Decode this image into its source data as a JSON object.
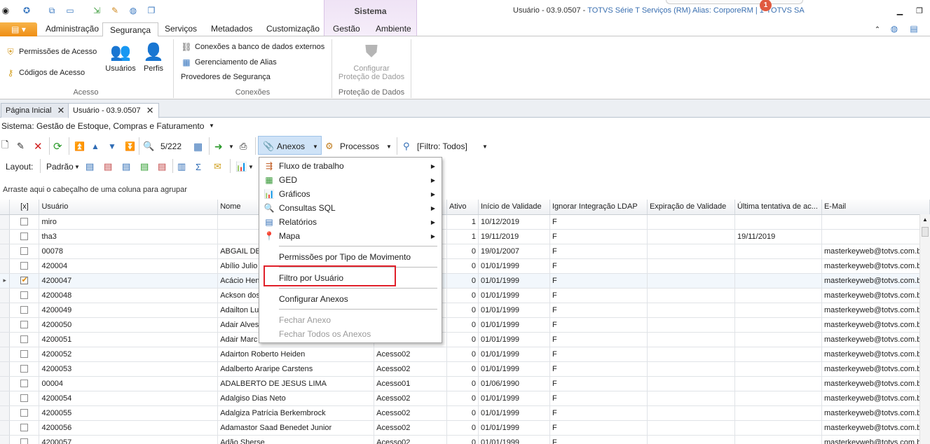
{
  "window": {
    "title_main": "Usuário - 03.9.0507 - ",
    "title_app": "TOTVS Série T Serviços (RM) Alias: CorporeRM | 1-TOTVS SA",
    "context_tab": "Sistema",
    "notification_count": "1"
  },
  "ribbon": {
    "tabs": [
      "Administração",
      "Segurança",
      "Serviços",
      "Metadados",
      "Customização",
      "Gestão",
      "Ambiente"
    ],
    "active_tab": "Segurança",
    "groups": {
      "acesso": {
        "label": "Acesso",
        "permissoes": "Permissões de Acesso",
        "codigos": "Códigos de Acesso",
        "usuarios": "Usuários",
        "perfis": "Perfis"
      },
      "conexoes": {
        "label": "Conexões",
        "banco": "Conexões a banco de dados externos",
        "alias": "Gerenciamento de Alias",
        "provedores": "Provedores de Segurança"
      },
      "protecao": {
        "label": "Proteção de Dados",
        "configurar_l1": "Configurar",
        "configurar_l2": "Proteção de Dados"
      }
    }
  },
  "doc_tabs": [
    "Página Inicial",
    "Usuário - 03.9.0507"
  ],
  "sistema": {
    "label": "Sistema:",
    "value": "Gestão de Estoque, Compras e Faturamento"
  },
  "toolbar": {
    "counter": "5/222",
    "anexos": "Anexos",
    "processos": "Processos",
    "filtro": "[Filtro: Todos]"
  },
  "layout_bar": {
    "label": "Layout:",
    "value": "Padrão"
  },
  "group_hint": "Arraste aqui o cabeçalho de uma coluna para agrupar",
  "grid": {
    "columns": [
      "[x]",
      "Usuário",
      "Nome",
      "",
      "Ativo",
      "Início de Validade",
      "Ignorar Integração LDAP",
      "Expiração de Validade",
      "Última tentativa de ac...",
      "E-Mail"
    ],
    "rows": [
      {
        "checked": false,
        "usuario": "miro",
        "nome": "",
        "perfil": "",
        "ativo": "1",
        "inicio": "10/12/2019",
        "ldap": "F",
        "expira": "",
        "ultima": "",
        "email": ""
      },
      {
        "checked": false,
        "usuario": "tha3",
        "nome": "",
        "perfil": "",
        "ativo": "1",
        "inicio": "19/11/2019",
        "ldap": "F",
        "expira": "",
        "ultima": "19/11/2019",
        "email": ""
      },
      {
        "checked": false,
        "usuario": "00078",
        "nome": "ABGAIL DE",
        "perfil": "",
        "ativo": "0",
        "inicio": "19/01/2007",
        "ldap": "F",
        "expira": "",
        "ultima": "",
        "email": "masterkeyweb@totvs.com.b"
      },
      {
        "checked": false,
        "usuario": "420004",
        "nome": "Abílio Julio",
        "perfil": "",
        "ativo": "0",
        "inicio": "01/01/1999",
        "ldap": "F",
        "expira": "",
        "ultima": "",
        "email": "masterkeyweb@totvs.com.b"
      },
      {
        "checked": true,
        "usuario": "4200047",
        "nome": "Acácio Hen",
        "perfil": "",
        "ativo": "0",
        "inicio": "01/01/1999",
        "ldap": "F",
        "expira": "",
        "ultima": "",
        "email": "masterkeyweb@totvs.com.b"
      },
      {
        "checked": false,
        "usuario": "4200048",
        "nome": "Ackson dos",
        "perfil": "",
        "ativo": "0",
        "inicio": "01/01/1999",
        "ldap": "F",
        "expira": "",
        "ultima": "",
        "email": "masterkeyweb@totvs.com.b"
      },
      {
        "checked": false,
        "usuario": "4200049",
        "nome": "Adailton Lu",
        "perfil": "",
        "ativo": "0",
        "inicio": "01/01/1999",
        "ldap": "F",
        "expira": "",
        "ultima": "",
        "email": "masterkeyweb@totvs.com.b"
      },
      {
        "checked": false,
        "usuario": "4200050",
        "nome": "Adair Alves",
        "perfil": "",
        "ativo": "0",
        "inicio": "01/01/1999",
        "ldap": "F",
        "expira": "",
        "ultima": "",
        "email": "masterkeyweb@totvs.com.b"
      },
      {
        "checked": false,
        "usuario": "4200051",
        "nome": "Adair Marc",
        "perfil": "",
        "ativo": "0",
        "inicio": "01/01/1999",
        "ldap": "F",
        "expira": "",
        "ultima": "",
        "email": "masterkeyweb@totvs.com.b"
      },
      {
        "checked": false,
        "usuario": "4200052",
        "nome": "Adairton Roberto Heiden",
        "perfil": "Acesso02",
        "ativo": "0",
        "inicio": "01/01/1999",
        "ldap": "F",
        "expira": "",
        "ultima": "",
        "email": "masterkeyweb@totvs.com.b"
      },
      {
        "checked": false,
        "usuario": "4200053",
        "nome": "Adalberto Araripe Carstens",
        "perfil": "Acesso02",
        "ativo": "0",
        "inicio": "01/01/1999",
        "ldap": "F",
        "expira": "",
        "ultima": "",
        "email": "masterkeyweb@totvs.com.b"
      },
      {
        "checked": false,
        "usuario": "00004",
        "nome": "ADALBERTO DE JESUS LIMA",
        "perfil": "Acesso01",
        "ativo": "0",
        "inicio": "01/06/1990",
        "ldap": "F",
        "expira": "",
        "ultima": "",
        "email": "masterkeyweb@totvs.com.b"
      },
      {
        "checked": false,
        "usuario": "4200054",
        "nome": "Adalgiso Dias Neto",
        "perfil": "Acesso02",
        "ativo": "0",
        "inicio": "01/01/1999",
        "ldap": "F",
        "expira": "",
        "ultima": "",
        "email": "masterkeyweb@totvs.com.b"
      },
      {
        "checked": false,
        "usuario": "4200055",
        "nome": "Adalgiza Patrícia Berkembrock",
        "perfil": "Acesso02",
        "ativo": "0",
        "inicio": "01/01/1999",
        "ldap": "F",
        "expira": "",
        "ultima": "",
        "email": "masterkeyweb@totvs.com.b"
      },
      {
        "checked": false,
        "usuario": "4200056",
        "nome": "Adamastor Saad Benedet Junior",
        "perfil": "Acesso02",
        "ativo": "0",
        "inicio": "01/01/1999",
        "ldap": "F",
        "expira": "",
        "ultima": "",
        "email": "masterkeyweb@totvs.com.b"
      },
      {
        "checked": false,
        "usuario": "4200057",
        "nome": "Adão Sherse",
        "perfil": "Acesso02",
        "ativo": "0",
        "inicio": "01/01/1999",
        "ldap": "F",
        "expira": "",
        "ultima": "",
        "email": "masterkeyweb@totvs.com.b"
      }
    ]
  },
  "anexos_menu": {
    "items": [
      {
        "label": "Fluxo de trabalho",
        "icon": "workflow-icon",
        "submenu": true,
        "disabled": false
      },
      {
        "label": "GED",
        "icon": "ged-icon",
        "submenu": true,
        "disabled": false
      },
      {
        "label": "Gráficos",
        "icon": "chart-icon",
        "submenu": true,
        "disabled": false
      },
      {
        "label": "Consultas SQL",
        "icon": "sql-query-icon",
        "submenu": true,
        "disabled": false
      },
      {
        "label": "Relatórios",
        "icon": "report-icon",
        "submenu": true,
        "disabled": false
      },
      {
        "label": "Mapa",
        "icon": "map-pin-icon",
        "submenu": true,
        "disabled": false
      },
      {
        "label": "Permissões por Tipo de Movimento",
        "icon": "",
        "submenu": false,
        "disabled": false
      },
      {
        "label": "Filtro por Usuário",
        "icon": "",
        "submenu": false,
        "disabled": false
      },
      {
        "label": "Configurar Anexos",
        "icon": "",
        "submenu": false,
        "disabled": false
      },
      {
        "label": "Fechar Anexo",
        "icon": "",
        "submenu": false,
        "disabled": true
      },
      {
        "label": "Fechar Todos os Anexos",
        "icon": "",
        "submenu": false,
        "disabled": true
      }
    ]
  },
  "colors": {
    "accent_orange": "#ef8e14",
    "highlight_red": "#e0202a",
    "anexos_hover": "#cfe3f7",
    "context_tab_bg": "#efe3f5"
  }
}
